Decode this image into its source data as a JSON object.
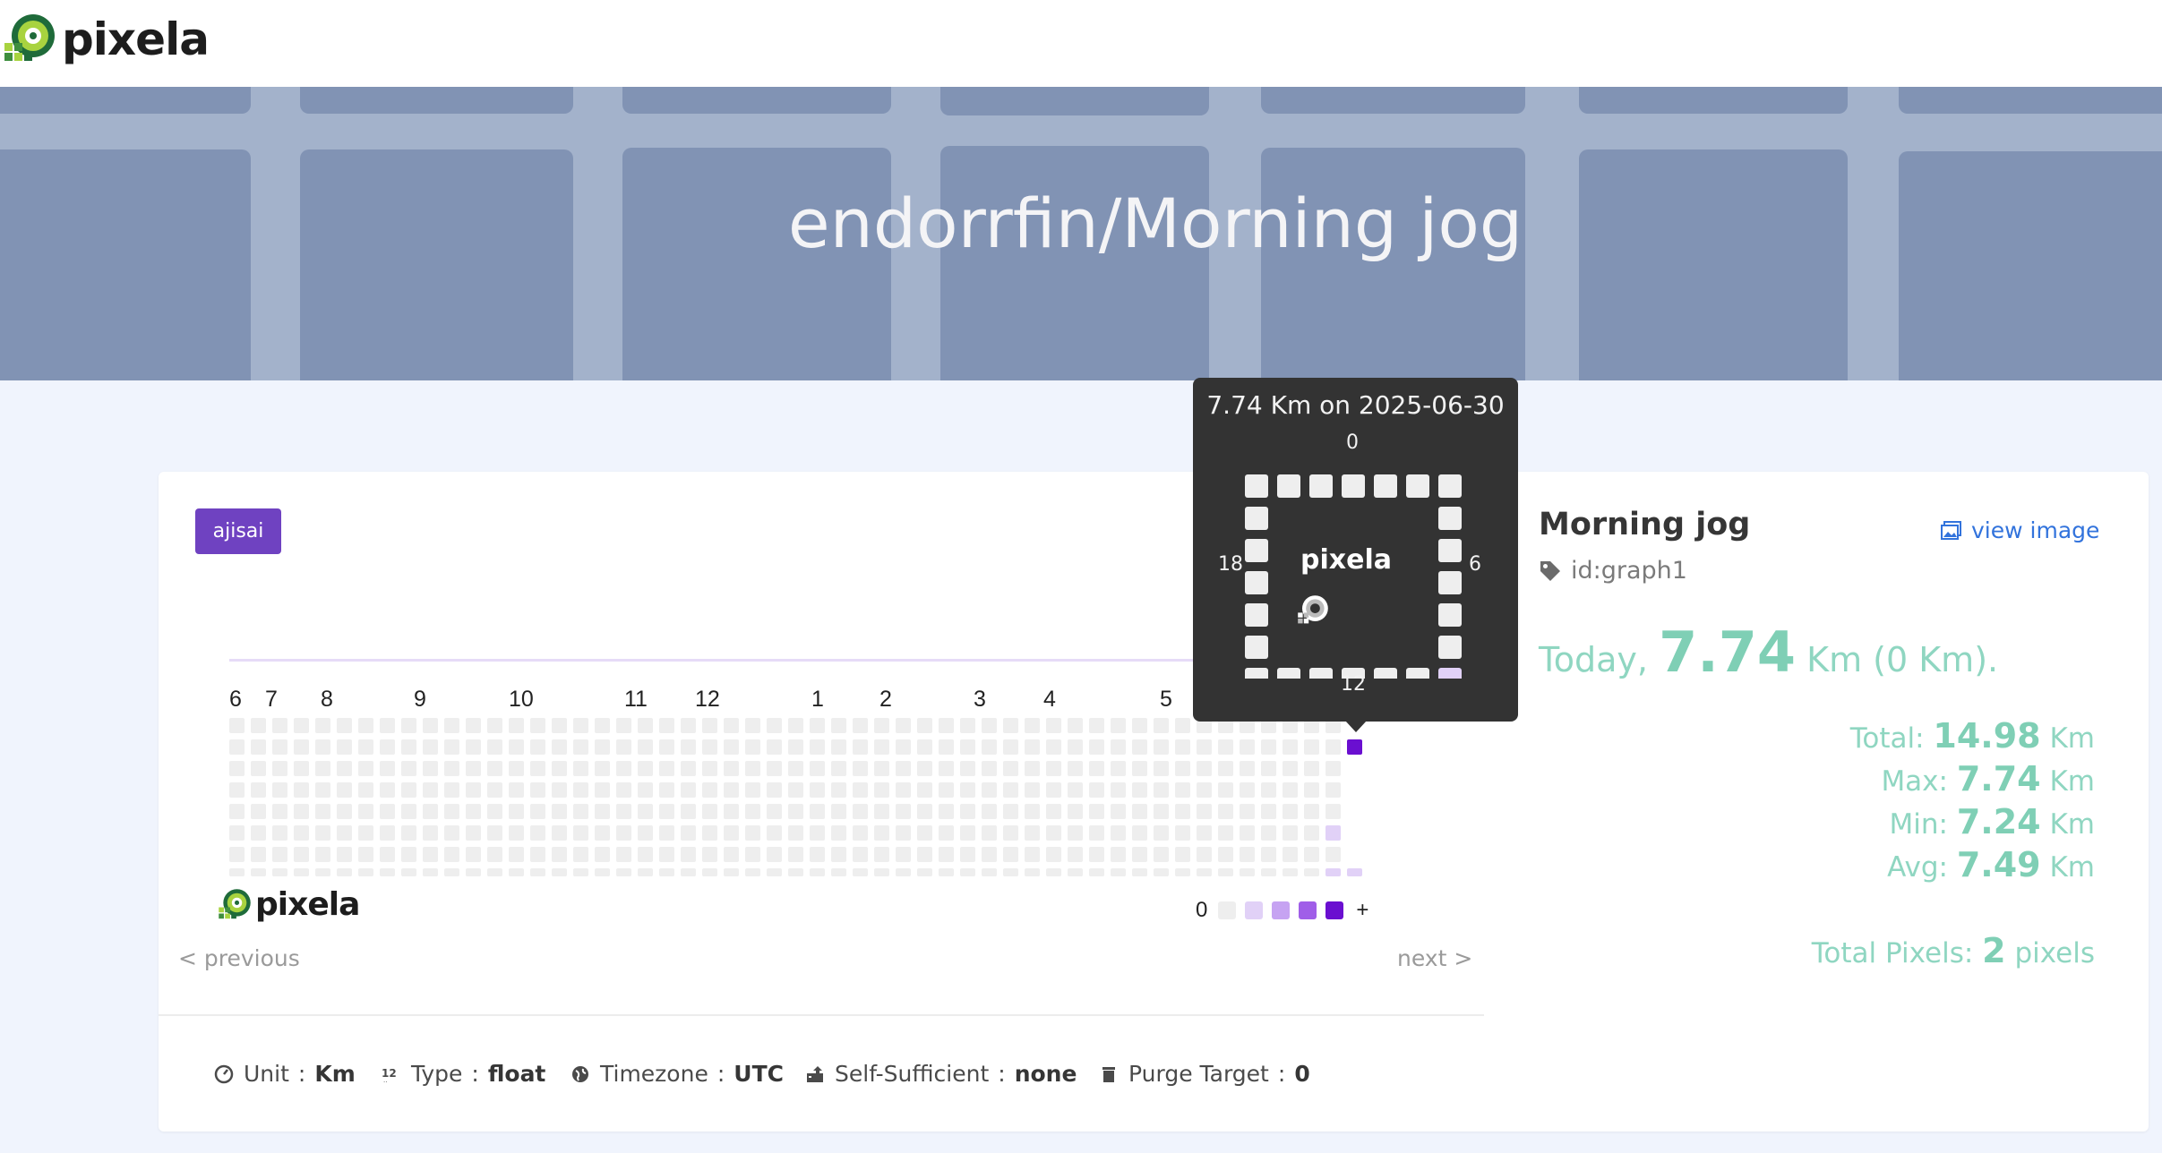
{
  "brand": {
    "name": "pixela"
  },
  "hero": {
    "title": "endorrfin/Morning jog"
  },
  "card": {
    "theme_tag": "ajisai",
    "months": [
      "6",
      "7",
      "8",
      "9",
      "10",
      "11",
      "12",
      "1",
      "2",
      "3",
      "4",
      "5"
    ],
    "legend": {
      "zero": "0",
      "plus": "+",
      "colors": [
        "#eeeeee",
        "#e1d1f7",
        "#c6a3f2",
        "#a05ee8",
        "#6a0fd0"
      ]
    },
    "pager": {
      "previous": "< previous",
      "next": "next >"
    },
    "meta": {
      "unit_label": "Unit",
      "unit_value": "Km",
      "type_label": "Type",
      "type_value": "float",
      "timezone_label": "Timezone",
      "timezone_value": "UTC",
      "self_sufficient_label": "Self-Sufficient",
      "self_sufficient_value": "none",
      "purge_label": "Purge Target",
      "purge_value": "0",
      "separator": ":"
    }
  },
  "side": {
    "title": "Morning jog",
    "view_image": "view image",
    "graph_id": "id:graph1",
    "today_prefix": "Today",
    "today_comma": ",",
    "today_value": "7.74",
    "today_suffix": "Km (0 Km).",
    "total_label": "Total:",
    "total_value": "14.98",
    "total_unit": "Km",
    "max_label": "Max:",
    "max_value": "7.74",
    "max_unit": "Km",
    "min_label": "Min:",
    "min_value": "7.24",
    "min_unit": "Km",
    "avg_label": "Avg:",
    "avg_value": "7.49",
    "avg_unit": "Km",
    "pixels_label": "Total Pixels:",
    "pixels_value": "2",
    "pixels_unit": "pixels"
  },
  "tooltip": {
    "title": "7.74 Km on 2025-06-30",
    "label_top": "0",
    "label_right": "6",
    "label_bottom": "12",
    "label_left": "18",
    "brand": "pixela"
  },
  "colors": {
    "accent": "#6f42c1",
    "stat": "#7fcfb5",
    "link": "#3273dc"
  }
}
